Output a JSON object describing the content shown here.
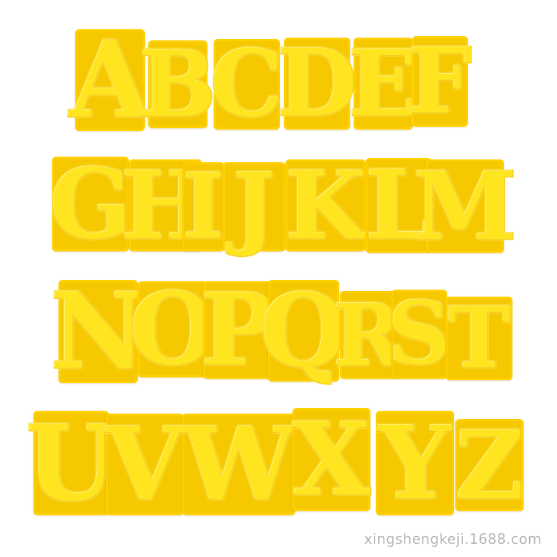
{
  "rows": [
    {
      "letters": [
        "A",
        "B",
        "C",
        "D",
        "E",
        "F"
      ]
    },
    {
      "letters": [
        "G",
        "H",
        "I",
        "J",
        "K",
        "L",
        "M"
      ]
    },
    {
      "letters": [
        "N",
        "O",
        "P",
        "Q",
        "R",
        "S",
        "T"
      ]
    },
    {
      "letters": [
        "U",
        "V",
        "W",
        "X",
        "Y",
        "Z"
      ]
    }
  ],
  "watermark": "xingshengkeji.1688.com",
  "colors": {
    "background": "#ffffff",
    "patch_felt": "#f5c800",
    "chenille": "#ffe11a",
    "watermark": "#8a8a8a"
  }
}
